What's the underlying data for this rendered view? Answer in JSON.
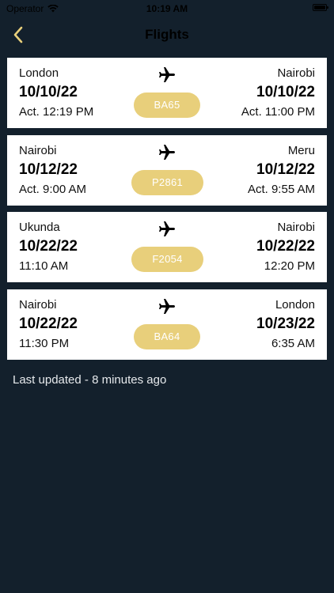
{
  "status_bar": {
    "carrier": "Operator",
    "time": "10:19 AM"
  },
  "nav": {
    "title": "Flights"
  },
  "colors": {
    "background": "#13202c",
    "accent": "#e8cf7b",
    "card": "#ffffff"
  },
  "flights": [
    {
      "origin_city": "London",
      "origin_date": "10/10/22",
      "origin_time": "Act. 12:19 PM",
      "dest_city": "Nairobi",
      "dest_date": "10/10/22",
      "dest_time": "Act. 11:00 PM",
      "flight_number": "BA65"
    },
    {
      "origin_city": "Nairobi",
      "origin_date": "10/12/22",
      "origin_time": "Act. 9:00 AM",
      "dest_city": "Meru",
      "dest_date": "10/12/22",
      "dest_time": "Act. 9:55 AM",
      "flight_number": "P2861"
    },
    {
      "origin_city": "Ukunda",
      "origin_date": "10/22/22",
      "origin_time": "11:10 AM",
      "dest_city": "Nairobi",
      "dest_date": "10/22/22",
      "dest_time": "12:20 PM",
      "flight_number": "F2054"
    },
    {
      "origin_city": "Nairobi",
      "origin_date": "10/22/22",
      "origin_time": "11:30 PM",
      "dest_city": "London",
      "dest_date": "10/23/22",
      "dest_time": "6:35 AM",
      "flight_number": "BA64"
    }
  ],
  "footer": {
    "last_updated": "Last updated - 8 minutes ago"
  }
}
